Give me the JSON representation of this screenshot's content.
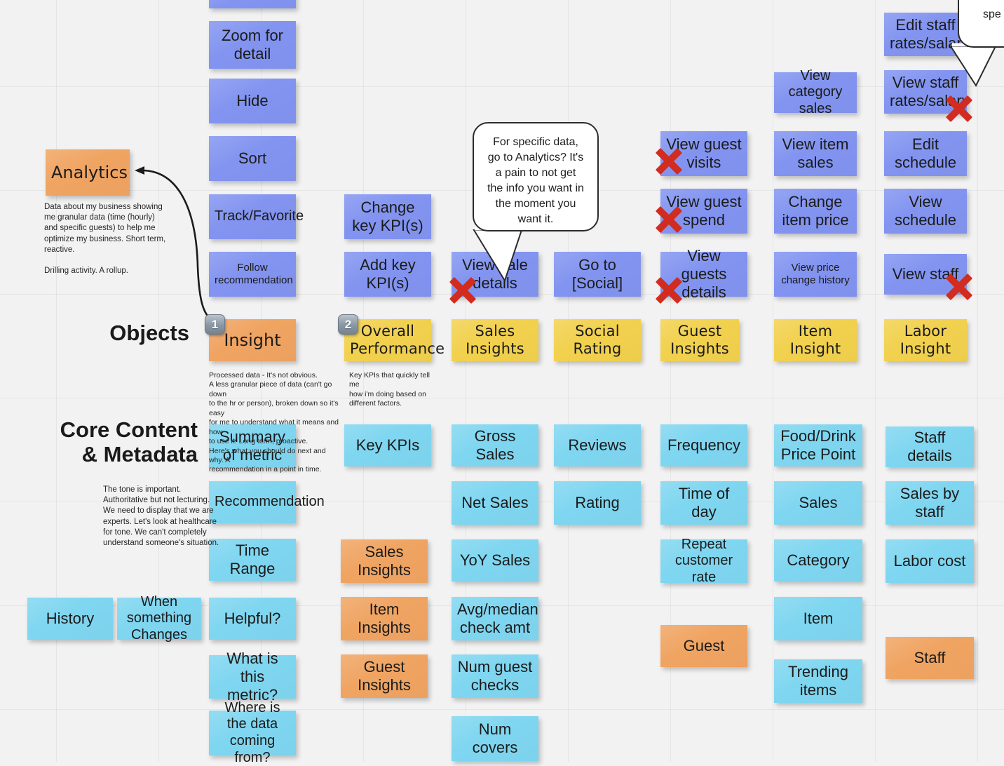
{
  "board": {
    "background_color": "#f2f2f2",
    "colors": {
      "purple": "#8294f0",
      "yellow": "#f2d14e",
      "blue": "#7fd6f0",
      "orange": "#f0a462",
      "x_mark_red": "#d22b1f"
    }
  },
  "section_labels": {
    "objects": "Objects",
    "core_content": "Core Content\n& Metadata"
  },
  "annotations": {
    "analytics_desc": "Data about my business showing\nme granular data (time (hourly)\nand specific guests) to help me\noptimize my business. Short term,\nreactive.\n\nDrilling activity. A rollup.",
    "insight_desc": "Processed data - It's not obvious.\nA less granular piece of data (can't go down\nto the hr or person), broken down so it's easy\nfor me to understand what it means and how\nto use it. Long term, proactive.\nHere's what you should do next and why. A\nrecommendation in a point in time.",
    "overall_performance_desc": "Key KPIs that quickly tell me\nhow i'm doing based on\ndifferent factors.",
    "tone_desc": "The tone is important.\nAuthoritative but not lecturing.\nWe need to display that we are\nexperts. Let's look at healthcare\nfor tone. We can't completely\nunderstand someone's situation."
  },
  "badges": [
    {
      "number": "1"
    },
    {
      "number": "2"
    }
  ],
  "bubbles": [
    {
      "text": "For specific data, go to Analytics? It's a pain to not get the info you want in the moment you want it."
    },
    {
      "text": "spe"
    }
  ],
  "notes": [
    {
      "id": "n-top-cut",
      "label": "",
      "color": "purple",
      "size": "md"
    },
    {
      "id": "n-zoom-for-detail",
      "label": "Zoom for detail",
      "color": "purple",
      "size": "lg"
    },
    {
      "id": "n-hide",
      "label": "Hide",
      "color": "purple",
      "size": "lg"
    },
    {
      "id": "n-sort",
      "label": "Sort",
      "color": "purple",
      "size": "lg"
    },
    {
      "id": "n-track-favorite",
      "label": "Track/Favorite",
      "color": "purple",
      "size": "md"
    },
    {
      "id": "n-follow-rec",
      "label": "Follow recommendation",
      "color": "purple",
      "size": "sm"
    },
    {
      "id": "n-change-key-kpis",
      "label": "Change key KPI(s)",
      "color": "purple",
      "size": "lg"
    },
    {
      "id": "n-add-key-kpis",
      "label": "Add key KPI(s)",
      "color": "purple",
      "size": "lg"
    },
    {
      "id": "n-view-sale-details",
      "label": "View sale details",
      "color": "purple",
      "size": "lg"
    },
    {
      "id": "n-go-to-social",
      "label": "Go to [Social]",
      "color": "purple",
      "size": "lg"
    },
    {
      "id": "n-view-guest-visits",
      "label": "View guest visits",
      "color": "purple",
      "size": "lg"
    },
    {
      "id": "n-view-guest-spend",
      "label": "View guest spend",
      "color": "purple",
      "size": "lg"
    },
    {
      "id": "n-view-guests-details",
      "label": "View guests details",
      "color": "purple",
      "size": "lg"
    },
    {
      "id": "n-view-category-sales",
      "label": "View category sales",
      "color": "purple",
      "size": "md"
    },
    {
      "id": "n-view-item-sales",
      "label": "View item sales",
      "color": "purple",
      "size": "lg"
    },
    {
      "id": "n-change-item-price",
      "label": "Change item price",
      "color": "purple",
      "size": "lg"
    },
    {
      "id": "n-view-price-history",
      "label": "View price change history",
      "color": "purple",
      "size": "sm"
    },
    {
      "id": "n-edit-staff-rates",
      "label": "Edit staff rates/salary",
      "color": "purple",
      "size": "lg"
    },
    {
      "id": "n-view-staff-rates",
      "label": "View staff rates/salary",
      "color": "purple",
      "size": "lg"
    },
    {
      "id": "n-edit-schedule",
      "label": "Edit schedule",
      "color": "purple",
      "size": "lg"
    },
    {
      "id": "n-view-schedule",
      "label": "View schedule",
      "color": "purple",
      "size": "lg"
    },
    {
      "id": "n-view-staff",
      "label": "View staff",
      "color": "purple",
      "size": "lg"
    },
    {
      "id": "n-analytics",
      "label": "Analytics",
      "color": "orange",
      "size": "hand-lg"
    },
    {
      "id": "n-insight",
      "label": "Insight",
      "color": "orange",
      "size": "hand-lg"
    },
    {
      "id": "n-overall-performance",
      "label": "Overall Performance",
      "color": "yellow",
      "size": "hand"
    },
    {
      "id": "n-sales-insights-y",
      "label": "Sales Insights",
      "color": "yellow",
      "size": "hand"
    },
    {
      "id": "n-social-rating",
      "label": "Social Rating",
      "color": "yellow",
      "size": "hand"
    },
    {
      "id": "n-guest-insights-y",
      "label": "Guest Insights",
      "color": "yellow",
      "size": "hand"
    },
    {
      "id": "n-item-insight",
      "label": "Item Insight",
      "color": "yellow",
      "size": "hand"
    },
    {
      "id": "n-labor-insight",
      "label": "Labor Insight",
      "color": "yellow",
      "size": "hand"
    },
    {
      "id": "n-summary-of-metric",
      "label": "Summary of metric",
      "color": "blue",
      "size": "lg"
    },
    {
      "id": "n-recommendation",
      "label": "Recommendation",
      "color": "blue",
      "size": "md"
    },
    {
      "id": "n-time-range",
      "label": "Time Range",
      "color": "blue",
      "size": "lg"
    },
    {
      "id": "n-helpful",
      "label": "Helpful?",
      "color": "blue",
      "size": "lg"
    },
    {
      "id": "n-what-is-metric",
      "label": "What is this metric?",
      "color": "blue",
      "size": "lg"
    },
    {
      "id": "n-where-data-from",
      "label": "Where is the data coming from?",
      "color": "blue",
      "size": "md"
    },
    {
      "id": "n-history",
      "label": "History",
      "color": "blue",
      "size": "lg"
    },
    {
      "id": "n-when-something",
      "label": "When something Changes",
      "color": "blue",
      "size": "md"
    },
    {
      "id": "n-key-kpis",
      "label": "Key KPIs",
      "color": "blue",
      "size": "lg"
    },
    {
      "id": "n-sales-insights-o",
      "label": "Sales Insights",
      "color": "orange",
      "size": "lg"
    },
    {
      "id": "n-item-insights-o",
      "label": "Item Insights",
      "color": "orange",
      "size": "lg"
    },
    {
      "id": "n-guest-insights-o",
      "label": "Guest Insights",
      "color": "orange",
      "size": "lg"
    },
    {
      "id": "n-gross-sales",
      "label": "Gross Sales",
      "color": "blue",
      "size": "lg"
    },
    {
      "id": "n-net-sales",
      "label": "Net Sales",
      "color": "blue",
      "size": "lg"
    },
    {
      "id": "n-yoy-sales",
      "label": "YoY Sales",
      "color": "blue",
      "size": "lg"
    },
    {
      "id": "n-avg-median-check",
      "label": "Avg/median check amt",
      "color": "blue",
      "size": "lg"
    },
    {
      "id": "n-num-guest-checks",
      "label": "Num guest checks",
      "color": "blue",
      "size": "lg"
    },
    {
      "id": "n-num-covers",
      "label": "Num covers",
      "color": "blue",
      "size": "lg"
    },
    {
      "id": "n-reviews",
      "label": "Reviews",
      "color": "blue",
      "size": "lg"
    },
    {
      "id": "n-rating",
      "label": "Rating",
      "color": "blue",
      "size": "lg"
    },
    {
      "id": "n-frequency",
      "label": "Frequency",
      "color": "blue",
      "size": "lg"
    },
    {
      "id": "n-time-of-day",
      "label": "Time of day",
      "color": "blue",
      "size": "lg"
    },
    {
      "id": "n-repeat-customer",
      "label": "Repeat customer rate",
      "color": "blue",
      "size": "md"
    },
    {
      "id": "n-guest",
      "label": "Guest",
      "color": "orange",
      "size": "lg"
    },
    {
      "id": "n-food-drink-price",
      "label": "Food/Drink Price Point",
      "color": "blue",
      "size": "lg"
    },
    {
      "id": "n-sales",
      "label": "Sales",
      "color": "blue",
      "size": "lg"
    },
    {
      "id": "n-category",
      "label": "Category",
      "color": "blue",
      "size": "lg"
    },
    {
      "id": "n-item",
      "label": "Item",
      "color": "blue",
      "size": "lg"
    },
    {
      "id": "n-trending-items",
      "label": "Trending items",
      "color": "blue",
      "size": "lg"
    },
    {
      "id": "n-staff-details",
      "label": "Staff details",
      "color": "blue",
      "size": "lg"
    },
    {
      "id": "n-sales-by-staff",
      "label": "Sales by staff",
      "color": "blue",
      "size": "lg"
    },
    {
      "id": "n-labor-cost",
      "label": "Labor cost",
      "color": "blue",
      "size": "lg"
    },
    {
      "id": "n-staff",
      "label": "Staff",
      "color": "orange",
      "size": "lg"
    }
  ]
}
